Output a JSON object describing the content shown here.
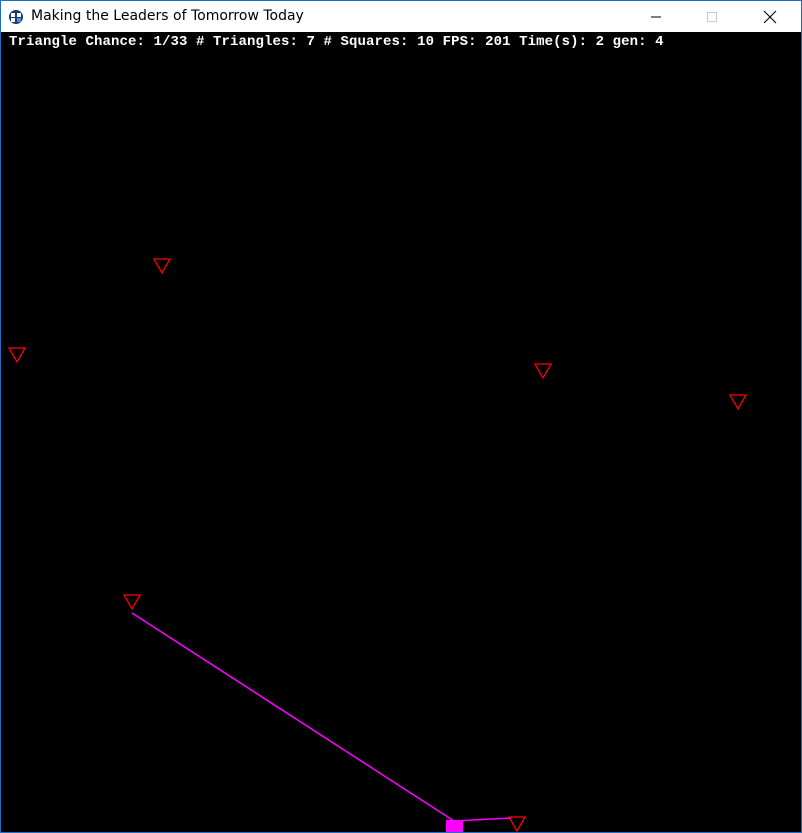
{
  "window": {
    "title": "Making the Leaders of Tomorrow Today",
    "app_icon": "pygame-app-icon"
  },
  "controls": {
    "minimize_icon": "minimize-icon",
    "maximize_icon": "maximize-icon",
    "close_icon": "close-icon"
  },
  "hud": {
    "text": "Triangle Chance: 1/33 # Triangles: 7 # Squares: 10 FPS: 201 Time(s): 2 gen: 4",
    "triangle_chance": "1/33",
    "triangles": 7,
    "squares": 10,
    "fps": 201,
    "time_s": 2,
    "gen": 4
  },
  "colors": {
    "background": "#000000",
    "triangle": "#ff0000",
    "square": "#ff00ff",
    "line": "#ff00ff",
    "hud_text": "#ffffff"
  }
}
